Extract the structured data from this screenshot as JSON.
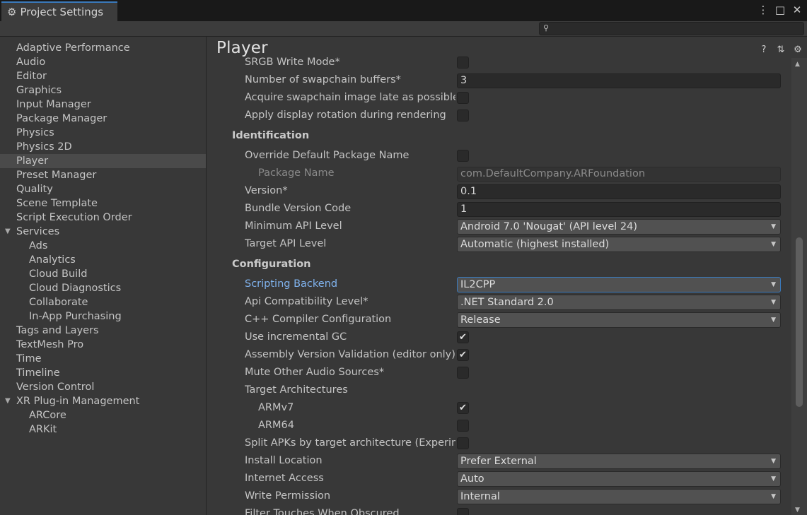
{
  "window": {
    "title": "Project Settings",
    "controls": [
      "⋮",
      "□",
      "✕"
    ]
  },
  "search": {
    "placeholder": ""
  },
  "sidebar": {
    "items": [
      {
        "label": "Adaptive Performance"
      },
      {
        "label": "Audio"
      },
      {
        "label": "Editor"
      },
      {
        "label": "Graphics"
      },
      {
        "label": "Input Manager"
      },
      {
        "label": "Package Manager"
      },
      {
        "label": "Physics"
      },
      {
        "label": "Physics 2D"
      },
      {
        "label": "Player",
        "selected": true
      },
      {
        "label": "Preset Manager"
      },
      {
        "label": "Quality"
      },
      {
        "label": "Scene Template"
      },
      {
        "label": "Script Execution Order"
      },
      {
        "label": "Services",
        "expanded": true
      },
      {
        "label": "Ads",
        "child": true
      },
      {
        "label": "Analytics",
        "child": true
      },
      {
        "label": "Cloud Build",
        "child": true
      },
      {
        "label": "Cloud Diagnostics",
        "child": true
      },
      {
        "label": "Collaborate",
        "child": true
      },
      {
        "label": "In-App Purchasing",
        "child": true
      },
      {
        "label": "Tags and Layers"
      },
      {
        "label": "TextMesh Pro"
      },
      {
        "label": "Time"
      },
      {
        "label": "Timeline"
      },
      {
        "label": "Version Control"
      },
      {
        "label": "XR Plug-in Management",
        "expanded": true
      },
      {
        "label": "ARCore",
        "child": true
      },
      {
        "label": "ARKit",
        "child": true
      }
    ]
  },
  "main": {
    "title": "Player",
    "head_icons": [
      "help-icon",
      "presets-icon",
      "settings-icon"
    ],
    "rows": [
      {
        "label": "SRGB Write Mode*",
        "control": "check",
        "checked": false
      },
      {
        "label": "Number of swapchain buffers*",
        "control": "field",
        "value": "3"
      },
      {
        "label": "Acquire swapchain image late as possible",
        "control": "check",
        "checked": false
      },
      {
        "label": "Apply display rotation during rendering",
        "control": "check",
        "checked": false
      }
    ],
    "identification": {
      "header": "Identification",
      "rows": [
        {
          "label": "Override Default Package Name",
          "control": "check",
          "checked": false
        },
        {
          "label": "Package Name",
          "control": "field",
          "value": "com.DefaultCompany.ARFoundation",
          "disabled": true
        },
        {
          "label": "Version*",
          "control": "field",
          "value": "0.1"
        },
        {
          "label": "Bundle Version Code",
          "control": "field",
          "value": "1"
        },
        {
          "label": "Minimum API Level",
          "control": "dropdown",
          "value": "Android 7.0 'Nougat' (API level 24)"
        },
        {
          "label": "Target API Level",
          "control": "dropdown",
          "value": "Automatic (highest installed)"
        }
      ]
    },
    "configuration": {
      "header": "Configuration",
      "rows": [
        {
          "label": "Scripting Backend",
          "control": "dropdown",
          "value": "IL2CPP",
          "focused": true
        },
        {
          "label": "Api Compatibility Level*",
          "control": "dropdown",
          "value": ".NET Standard 2.0"
        },
        {
          "label": "C++ Compiler Configuration",
          "control": "dropdown",
          "value": "Release"
        },
        {
          "label": "Use incremental GC",
          "control": "check",
          "checked": true
        },
        {
          "label": "Assembly Version Validation (editor only)",
          "control": "check",
          "checked": true
        },
        {
          "label": "Mute Other Audio Sources*",
          "control": "check",
          "checked": false
        },
        {
          "label": "Target Architectures",
          "control": "none"
        },
        {
          "label": "ARMv7",
          "control": "check",
          "checked": true,
          "sub": true
        },
        {
          "label": "ARM64",
          "control": "check",
          "checked": false,
          "sub": true
        },
        {
          "label": "Split APKs by target architecture (Experimental)",
          "control": "check",
          "checked": false
        },
        {
          "label": "Install Location",
          "control": "dropdown",
          "value": "Prefer External"
        },
        {
          "label": "Internet Access",
          "control": "dropdown",
          "value": "Auto"
        },
        {
          "label": "Write Permission",
          "control": "dropdown",
          "value": "Internal"
        },
        {
          "label": "Filter Touches When Obscured",
          "control": "check",
          "checked": false
        }
      ]
    }
  },
  "glyphs": {
    "check": "✔",
    "caret": "▼",
    "arrow_down": "▼",
    "scroll_up": "▲",
    "scroll_down": "▼",
    "search": "🔍",
    "gear": "⚙"
  }
}
